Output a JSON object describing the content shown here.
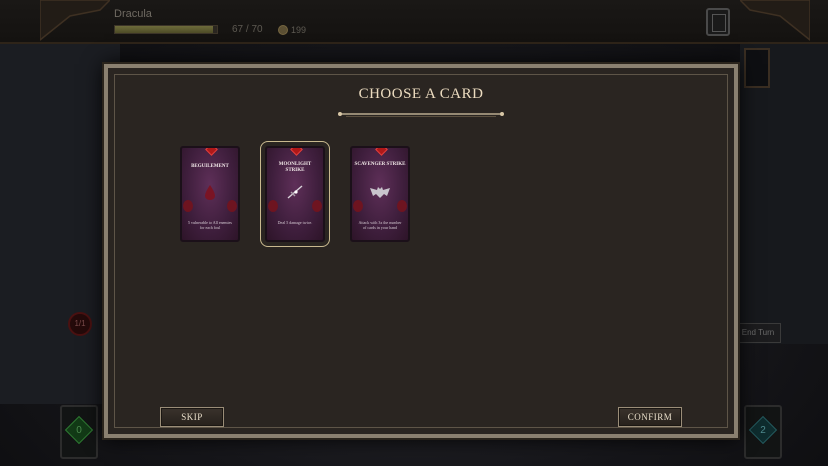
{
  "hud": {
    "player_name": "Dracula",
    "hp_text": "67 / 70",
    "hp_fraction": 0.957,
    "gold": "199",
    "deck_icon": "deck-icon"
  },
  "modal": {
    "title": "CHOOSE A CARD",
    "skip_label": "SKIP",
    "confirm_label": "CONFIRM",
    "cards": [
      {
        "name": "BEGUILEMENT",
        "description": "5 vulnerable to All enemies for each foul",
        "selected": false
      },
      {
        "name": "MOONLIGHT STRIKE",
        "description": "Deal 5 damage twice.",
        "selected": true
      },
      {
        "name": "SCAVENGER STRIKE",
        "description": "Attack with 3x the number of cards in your hand",
        "selected": false
      }
    ]
  },
  "bottom": {
    "draw_count": "0",
    "discard_count": "2",
    "end_turn_label": "End Turn",
    "energy": "1/1"
  },
  "colors": {
    "accent": "#b01818",
    "title": "#ecdcc0",
    "card_bg": "#3e1e3c",
    "frame": "#8a8070"
  }
}
